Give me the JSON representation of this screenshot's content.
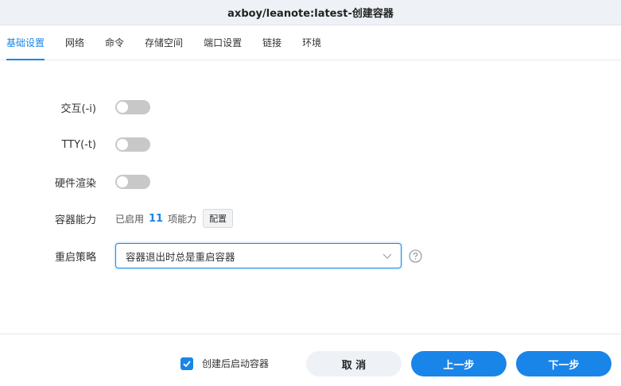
{
  "window": {
    "title": "axboy/leanote:latest-创建容器"
  },
  "tabs": [
    {
      "label": "基础设置",
      "active": true
    },
    {
      "label": "网络",
      "active": false
    },
    {
      "label": "命令",
      "active": false
    },
    {
      "label": "存储空间",
      "active": false
    },
    {
      "label": "端口设置",
      "active": false
    },
    {
      "label": "链接",
      "active": false
    },
    {
      "label": "环境",
      "active": false
    }
  ],
  "form": {
    "interactive": {
      "label": "交互(-i)",
      "enabled": false
    },
    "tty": {
      "label": "TTY(-t)",
      "enabled": false
    },
    "hw_render": {
      "label": "硬件渲染",
      "enabled": false
    },
    "capabilities": {
      "label": "容器能力",
      "prefix": "已启用",
      "count": "11",
      "suffix": "项能力",
      "config_button": "配置"
    },
    "restart_policy": {
      "label": "重启策略",
      "value": "容器退出时总是重启容器"
    }
  },
  "footer": {
    "autostart_label": "创建后启动容器",
    "autostart_checked": true,
    "cancel_label": "取 消",
    "prev_label": "上一步",
    "next_label": "下一步"
  },
  "colors": {
    "accent": "#1a85e8",
    "toggle_off": "#c8c8c8",
    "titlebar_bg": "#eef1f5"
  }
}
